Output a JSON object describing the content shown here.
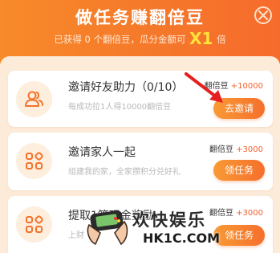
{
  "header": {
    "title": "做任务赚翻倍豆",
    "subtitle_prefix": "已获得 0 个翻倍豆，瓜分金额可",
    "multiplier": "X1",
    "subtitle_suffix": "倍",
    "close_icon": "close-icon"
  },
  "tasks": [
    {
      "title": "邀请好友助力（0/10）",
      "desc": "每成功拉1人得10000翻倍豆",
      "reward_label": "翻倍豆",
      "reward_amount": "+10000",
      "button": "去邀请",
      "icon": "users-icon"
    },
    {
      "title": "邀请家人一起",
      "desc": "组建我的家，全家攒积分兑好礼",
      "reward_label": "翻倍豆",
      "reward_amount": "+3000",
      "button": "领任务",
      "icon": "grid-icon"
    },
    {
      "title": "提取1笔现金奖励",
      "desc": "上财",
      "reward_label": "翻倍豆",
      "reward_amount": "+3000",
      "button": "领任务",
      "icon": "grid-icon"
    }
  ],
  "watermark": {
    "text": "欢快娱乐",
    "url": "HK1C.COM",
    "icon": "game-controller-icon"
  },
  "colors": {
    "header_start": "#f88a2a",
    "header_end": "#f66b2c",
    "accent": "#f4602c",
    "multiplier": "#ffe23a",
    "arrow": "#e62020"
  }
}
